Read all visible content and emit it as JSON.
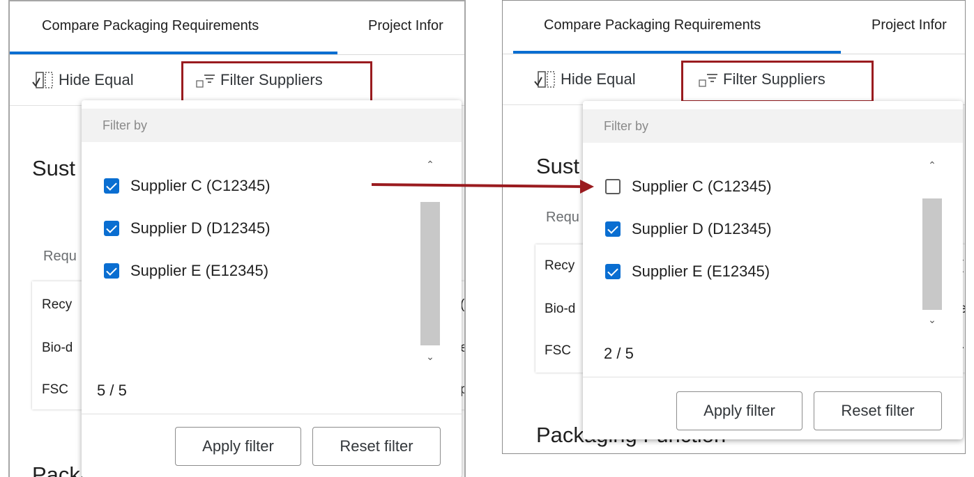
{
  "tabs": {
    "compare": "Compare Packaging Requirements",
    "project": "Project Infor"
  },
  "toolbar": {
    "hide_equal": "Hide Equal",
    "filter_suppliers": "Filter Suppliers"
  },
  "background": {
    "section_title_partial": "Sust",
    "requirements_label_partial": "Requ",
    "rows_partial": [
      "Recy",
      "Bio-d",
      "FSC"
    ],
    "left_right_edge_chars": [
      "(",
      "e",
      "p"
    ],
    "right_right_edge_chars": [
      "(",
      "e",
      "r"
    ],
    "packaging_function": "Packaging Function"
  },
  "popover": {
    "header": "Filter by",
    "apply_label": "Apply filter",
    "reset_label": "Reset filter"
  },
  "before": {
    "suppliers": [
      {
        "label": "Supplier C (C12345)",
        "checked": true
      },
      {
        "label": "Supplier D (D12345)",
        "checked": true
      },
      {
        "label": "Supplier E (E12345)",
        "checked": true
      }
    ],
    "count": "5  / 5"
  },
  "after": {
    "suppliers": [
      {
        "label": "Supplier C (C12345)",
        "checked": false
      },
      {
        "label": "Supplier D (D12345)",
        "checked": true
      },
      {
        "label": "Supplier E (E12345)",
        "checked": true
      }
    ],
    "count": "2 / 5"
  },
  "colors": {
    "accent": "#0a6ed1",
    "highlight": "#9a1b1f"
  }
}
